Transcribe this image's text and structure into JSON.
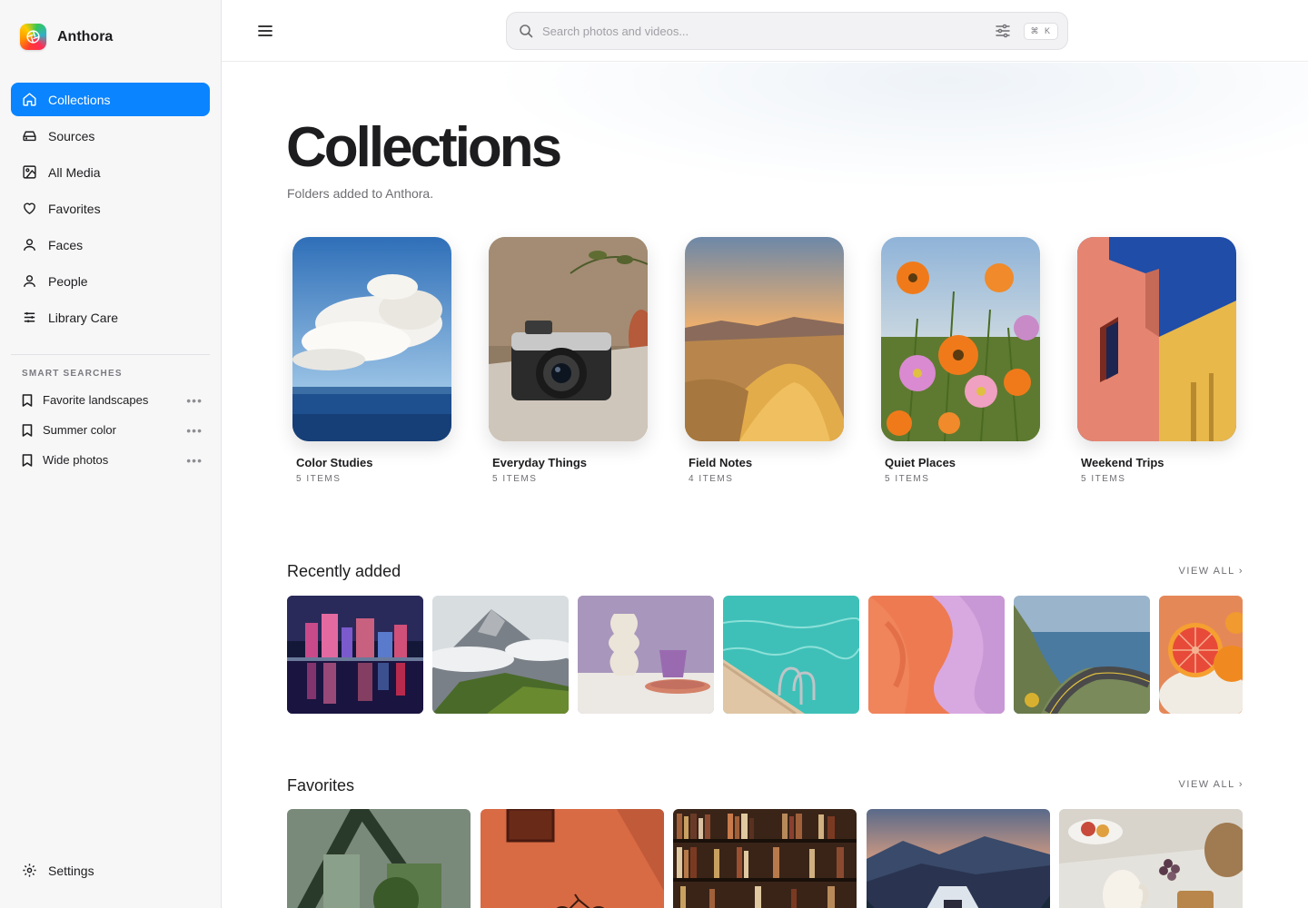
{
  "app": {
    "name": "Anthora"
  },
  "sidebar": {
    "items": [
      {
        "label": "Collections",
        "icon": "home-icon",
        "active": true
      },
      {
        "label": "Sources",
        "icon": "drive-icon"
      },
      {
        "label": "All Media",
        "icon": "image-icon"
      },
      {
        "label": "Favorites",
        "icon": "heart-icon"
      },
      {
        "label": "Faces",
        "icon": "person-icon"
      },
      {
        "label": "People",
        "icon": "person-icon"
      },
      {
        "label": "Library Care",
        "icon": "sliders-icon"
      }
    ],
    "smart_searches_title": "SMART SEARCHES",
    "smart_searches": [
      {
        "label": "Favorite landscapes"
      },
      {
        "label": "Summer color"
      },
      {
        "label": "Wide photos"
      }
    ],
    "settings_label": "Settings"
  },
  "search": {
    "placeholder": "Search photos and videos...",
    "shortcut": "⌘ K"
  },
  "main": {
    "title": "Collections",
    "subtitle": "Folders added to Anthora.",
    "collections": [
      {
        "name": "Color Studies",
        "count": "5 ITEMS"
      },
      {
        "name": "Everyday Things",
        "count": "5 ITEMS"
      },
      {
        "name": "Field Notes",
        "count": "4 ITEMS"
      },
      {
        "name": "Quiet Places",
        "count": "5 ITEMS"
      },
      {
        "name": "Weekend Trips",
        "count": "5 ITEMS"
      }
    ],
    "recent": {
      "title": "Recently added",
      "view_all": "VIEW ALL ›"
    },
    "favorites": {
      "title": "Favorites",
      "view_all": "VIEW ALL ›"
    }
  },
  "colors": {
    "accent": "#0a84ff",
    "sidebar_bg": "#f7f7f8"
  }
}
